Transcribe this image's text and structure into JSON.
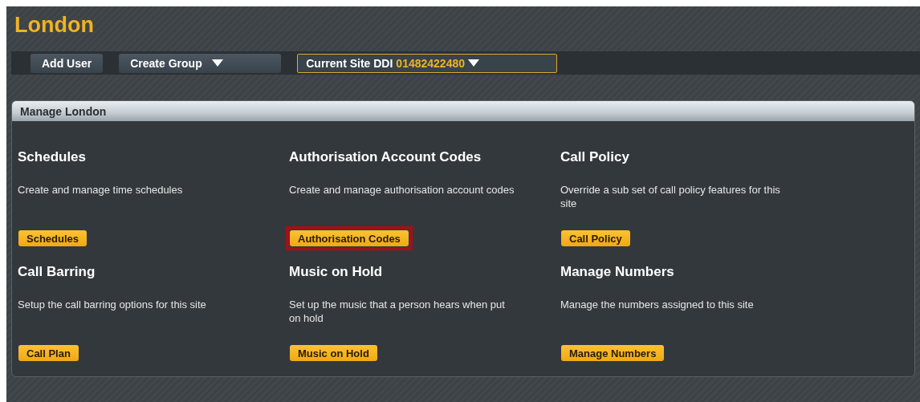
{
  "title": "London",
  "toolbar": {
    "buttons": [
      {
        "label": "Add User",
        "kind": "plain"
      },
      {
        "label": "Create Group",
        "kind": "dropdown"
      }
    ],
    "site_ddi": {
      "label": "Current Site DDI",
      "value": "01482422480"
    }
  },
  "panel": {
    "title": "Manage London",
    "sections": [
      {
        "heading": "Schedules",
        "description": "Create and manage time schedules",
        "button": "Schedules",
        "highlighted": false
      },
      {
        "heading": "Authorisation Account Codes",
        "description": "Create and manage authorisation account codes",
        "button": "Authorisation Codes",
        "highlighted": true
      },
      {
        "heading": "Call Policy",
        "description": "Override a sub set of call policy features for this site",
        "button": "Call Policy",
        "highlighted": false
      },
      {
        "heading": "Call Barring",
        "description": "Setup the call barring options for this site",
        "button": "Call Plan",
        "highlighted": false
      },
      {
        "heading": "Music on Hold",
        "description": "Set up the music that a person hears when put on hold",
        "button": "Music on Hold",
        "highlighted": false
      },
      {
        "heading": "Manage Numbers",
        "description": "Manage the numbers assigned to this site",
        "button": "Manage Numbers",
        "highlighted": false
      }
    ]
  }
}
